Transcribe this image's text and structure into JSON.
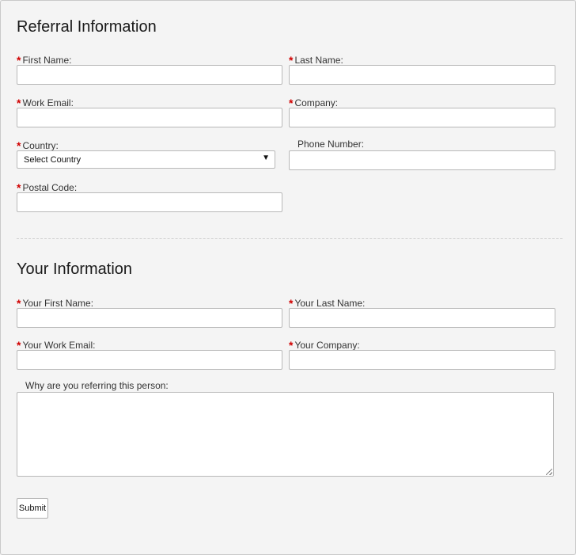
{
  "referral": {
    "title": "Referral Information",
    "first_name": {
      "label": "First Name:",
      "required": true,
      "value": ""
    },
    "last_name": {
      "label": "Last Name:",
      "required": true,
      "value": ""
    },
    "work_email": {
      "label": "Work Email:",
      "required": true,
      "value": ""
    },
    "company": {
      "label": "Company:",
      "required": true,
      "value": ""
    },
    "country": {
      "label": "Country:",
      "required": true,
      "selected": "Select Country"
    },
    "phone": {
      "label": "Phone Number:",
      "required": false,
      "value": ""
    },
    "postal_code": {
      "label": "Postal Code:",
      "required": true,
      "value": ""
    }
  },
  "you": {
    "title": "Your Information",
    "first_name": {
      "label": "Your First Name:",
      "required": true,
      "value": ""
    },
    "last_name": {
      "label": "Your Last Name:",
      "required": true,
      "value": ""
    },
    "work_email": {
      "label": "Your Work Email:",
      "required": true,
      "value": ""
    },
    "company": {
      "label": "Your Company:",
      "required": true,
      "value": ""
    },
    "reason": {
      "label": "Why are you referring this person:",
      "required": false,
      "value": ""
    }
  },
  "submit_label": "Submit",
  "required_marker": "*",
  "dropdown_arrow": "▼",
  "colors": {
    "background": "#f4f4f4",
    "required": "#d00000",
    "border": "#b8b8b8"
  }
}
